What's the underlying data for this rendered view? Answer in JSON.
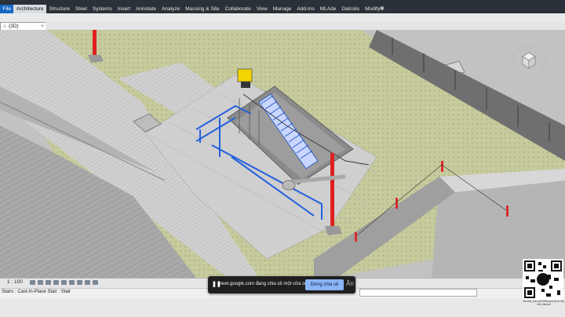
{
  "ribbon": {
    "tabs": [
      "File",
      "Architecture",
      "Structure",
      "Steel",
      "Systems",
      "Insert",
      "Annotate",
      "Analyze",
      "Massing & Site",
      "Collaborate",
      "View",
      "Manage",
      "Add-Ins",
      "MLAde",
      "Dalcolis",
      "Modify"
    ],
    "active_index": 1,
    "extra_icon": "camera-icon"
  },
  "view_tab": {
    "label": "{3D}",
    "icon": "3d-view-icon",
    "close": "×"
  },
  "view_bar": {
    "scale": "1 : 100"
  },
  "status_bar": {
    "text": "Stairs : Cast-In-Place Stair : Stair"
  },
  "screen_share": {
    "message": "meet.google.com đang chia sẻ một cửa sổ.",
    "stop_label": "Dừng chia sẻ",
    "hide_label": "Ẩn"
  },
  "qr": {
    "caption": "Ms.Dus_Học-phổ BIM quốc-tế-từ Mỹ-trên-Internet"
  },
  "colors": {
    "ribbon_bg": "#2b3138",
    "file_tab": "#1668c4",
    "grass": "#c6c99a",
    "pavement": "#cfcfcf",
    "rail": "#2460e0",
    "column": "#e02020"
  }
}
